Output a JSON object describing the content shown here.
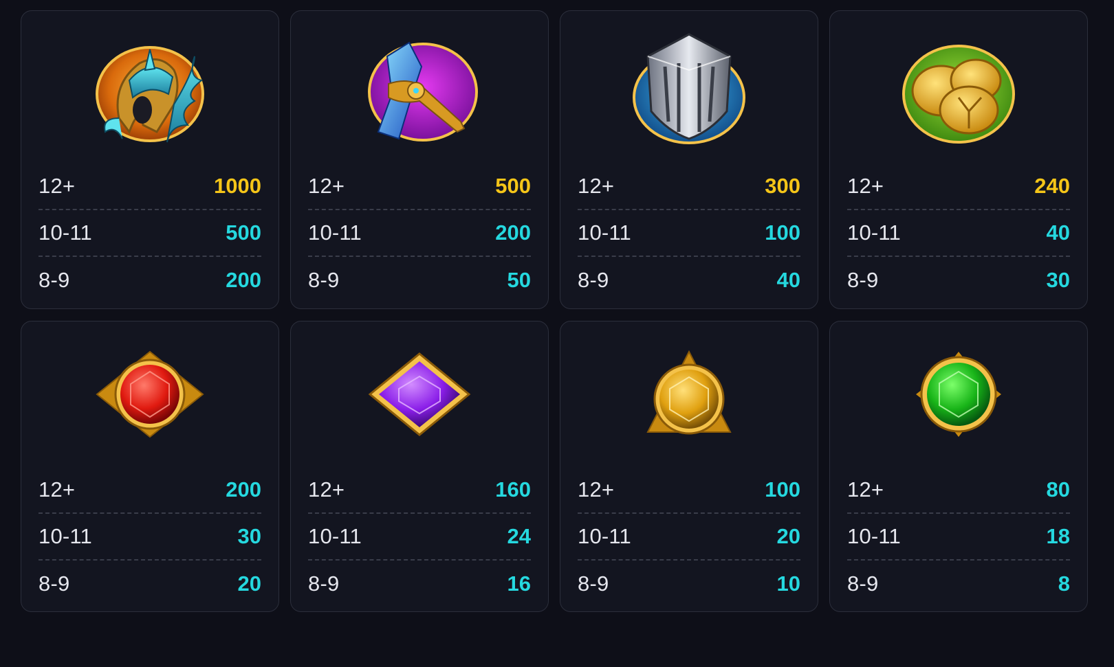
{
  "colors": {
    "background": "#0e0f18",
    "card": "#131520",
    "top_payout": "#f5c518",
    "payout": "#25d8df",
    "count_text": "#e6e7ee"
  },
  "symbols": [
    {
      "icon": "winged-helmet-icon",
      "rows": [
        {
          "count": "12+",
          "value": "1000",
          "highlight": true
        },
        {
          "count": "10-11",
          "value": "500",
          "highlight": false
        },
        {
          "count": "8-9",
          "value": "200",
          "highlight": false
        }
      ]
    },
    {
      "icon": "golden-hammer-icon",
      "rows": [
        {
          "count": "12+",
          "value": "500",
          "highlight": true
        },
        {
          "count": "10-11",
          "value": "200",
          "highlight": false
        },
        {
          "count": "8-9",
          "value": "50",
          "highlight": false
        }
      ]
    },
    {
      "icon": "steel-shield-icon",
      "rows": [
        {
          "count": "12+",
          "value": "300",
          "highlight": true
        },
        {
          "count": "10-11",
          "value": "100",
          "highlight": false
        },
        {
          "count": "8-9",
          "value": "40",
          "highlight": false
        }
      ]
    },
    {
      "icon": "gold-coins-icon",
      "rows": [
        {
          "count": "12+",
          "value": "240",
          "highlight": true
        },
        {
          "count": "10-11",
          "value": "40",
          "highlight": false
        },
        {
          "count": "8-9",
          "value": "30",
          "highlight": false
        }
      ]
    },
    {
      "icon": "red-gem-icon",
      "rows": [
        {
          "count": "12+",
          "value": "200",
          "highlight": false
        },
        {
          "count": "10-11",
          "value": "30",
          "highlight": false
        },
        {
          "count": "8-9",
          "value": "20",
          "highlight": false
        }
      ]
    },
    {
      "icon": "purple-gem-icon",
      "rows": [
        {
          "count": "12+",
          "value": "160",
          "highlight": false
        },
        {
          "count": "10-11",
          "value": "24",
          "highlight": false
        },
        {
          "count": "8-9",
          "value": "16",
          "highlight": false
        }
      ]
    },
    {
      "icon": "yellow-gem-icon",
      "rows": [
        {
          "count": "12+",
          "value": "100",
          "highlight": false
        },
        {
          "count": "10-11",
          "value": "20",
          "highlight": false
        },
        {
          "count": "8-9",
          "value": "10",
          "highlight": false
        }
      ]
    },
    {
      "icon": "green-gem-icon",
      "rows": [
        {
          "count": "12+",
          "value": "80",
          "highlight": false
        },
        {
          "count": "10-11",
          "value": "18",
          "highlight": false
        },
        {
          "count": "8-9",
          "value": "8",
          "highlight": false
        }
      ]
    }
  ]
}
